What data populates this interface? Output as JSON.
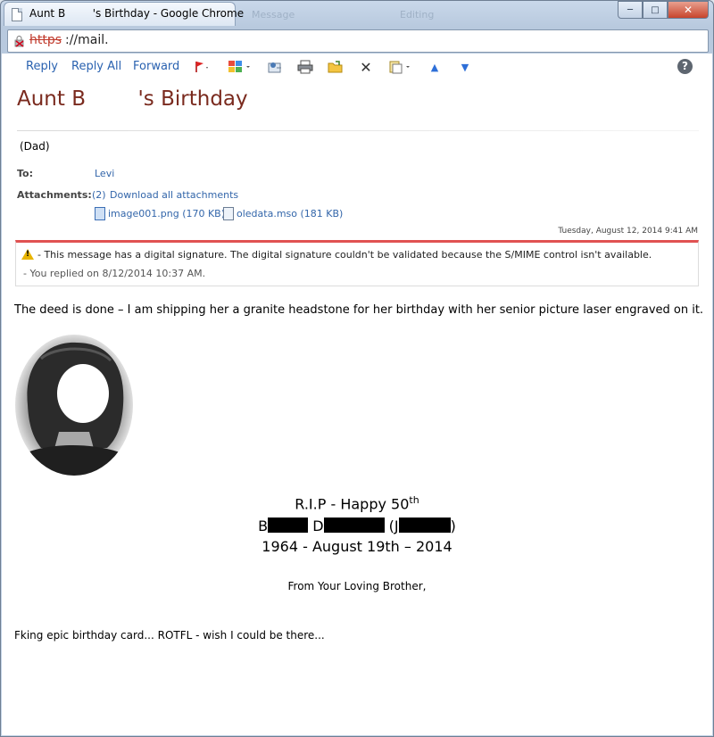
{
  "window": {
    "tab_title": "Aunt B        's Birthday - Google Chrome",
    "bg_tabs": [
      "Message",
      "Editing"
    ]
  },
  "address": {
    "scheme": "https",
    "rest": "://mail."
  },
  "toolbar": {
    "reply": "Reply",
    "reply_all": "Reply All",
    "forward": "Forward",
    "help": "?"
  },
  "message": {
    "subject": "Aunt B        's Birthday",
    "from": "(Dad)",
    "to_label": "To:",
    "to_value": "Levi",
    "attach_label": "Attachments:",
    "attach_count": "(2)",
    "download_all": "Download all attachments",
    "file1": "image001.png (170 KB);",
    "file2": "oledata.mso (181 KB)",
    "date": "Tuesday, August 12, 2014 9:41 AM",
    "warning": "- This message has a digital signature. The digital signature couldn't be validated because the S/MIME control isn't available.",
    "replied": "- You replied on 8/12/2014 10:37 AM.",
    "body1": "The deed is done – I am shipping her a granite headstone for her birthday with her senior picture laser engraved on it.",
    "rip_line": "R.I.P - Happy 50",
    "rip_sup": "th",
    "name_b": "B",
    "name_d": "D",
    "name_j_open": "(J",
    "name_close": ")",
    "years": "1964 - August 19th – 2014",
    "closing": "From Your Loving Brother,",
    "body2": "Fking epic birthday card...  ROTFL  - wish I could be there..."
  }
}
